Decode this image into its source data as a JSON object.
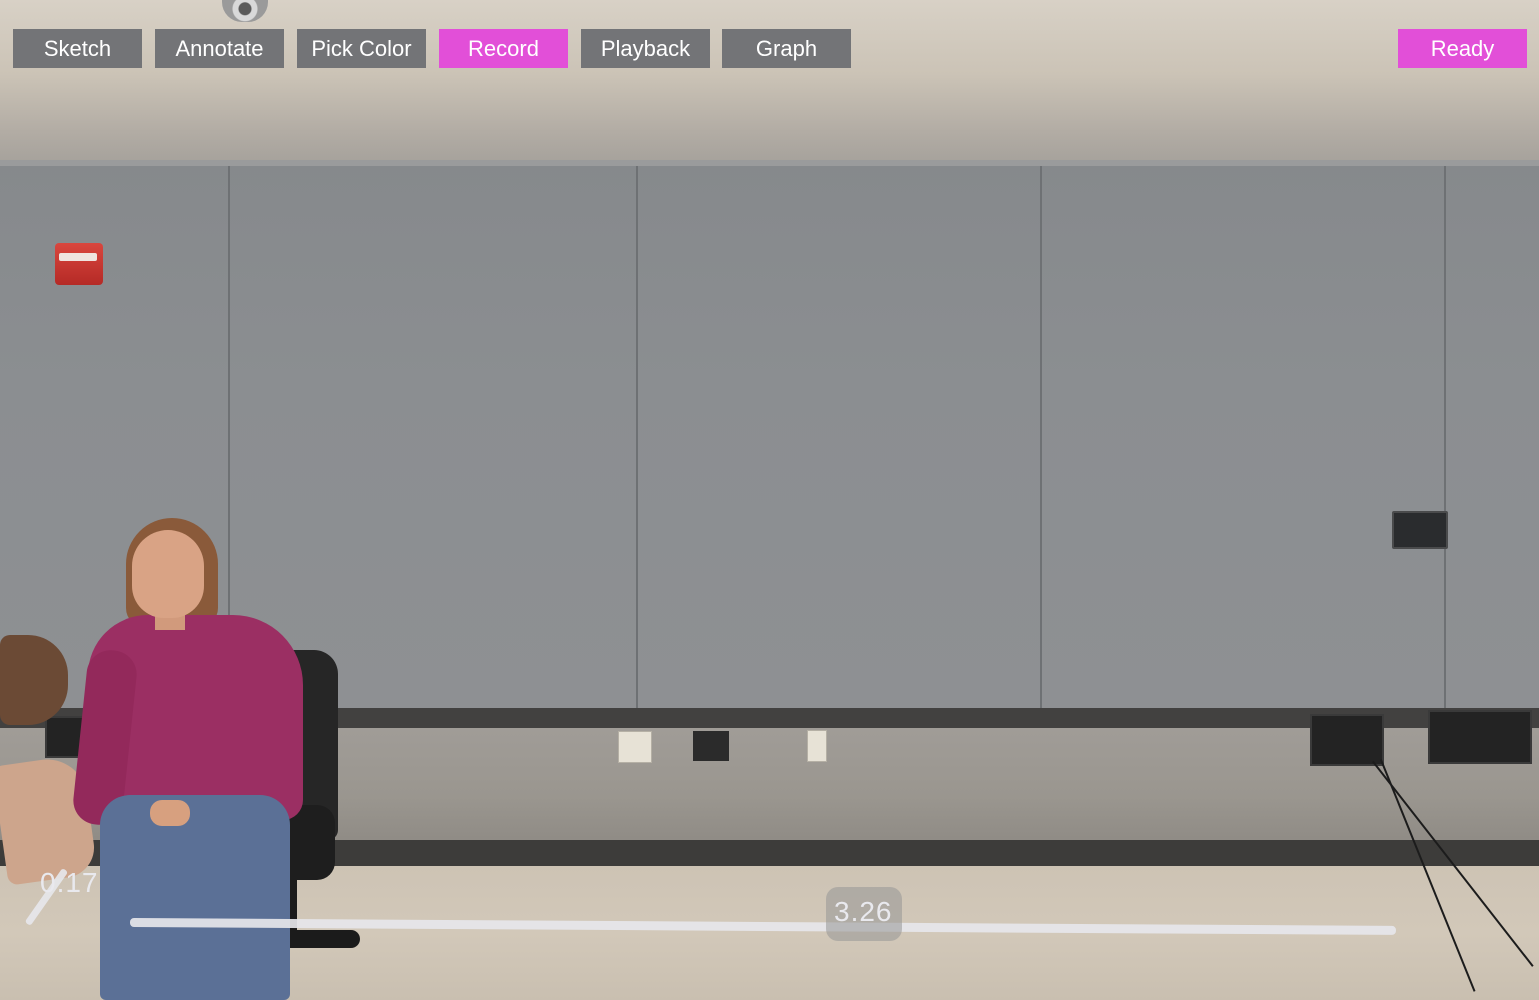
{
  "toolbar": {
    "buttons": [
      {
        "id": "sketch",
        "label": "Sketch"
      },
      {
        "id": "annotate",
        "label": "Annotate"
      },
      {
        "id": "pick_color",
        "label": "Pick Color"
      },
      {
        "id": "record",
        "label": "Record",
        "active": true
      },
      {
        "id": "playback",
        "label": "Playback"
      },
      {
        "id": "graph",
        "label": "Graph"
      }
    ],
    "status_label": "Ready"
  },
  "measurements": {
    "start_reading": "0.17",
    "distance_reading": "3.26"
  },
  "colors": {
    "button_default": "#737477",
    "button_accent": "#e24fd8",
    "button_text": "#ffffff",
    "measure_line": "#e6e6ea"
  }
}
